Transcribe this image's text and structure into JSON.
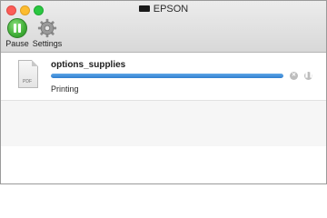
{
  "window": {
    "title": "EPSON",
    "title_icon": "printer-icon"
  },
  "toolbar": {
    "pause": {
      "label": "Pause",
      "icon": "pause-icon",
      "color": "#3fae36"
    },
    "settings": {
      "label": "Settings",
      "icon": "gear-icon"
    }
  },
  "jobs": [
    {
      "name": "options_supplies",
      "file_icon": "pdf-file-icon",
      "file_type": "PDF",
      "status": "Printing",
      "progress": 1.0,
      "progress_color": "#2f7fd0",
      "actions": [
        "cancel-icon",
        "hold-icon"
      ]
    }
  ]
}
